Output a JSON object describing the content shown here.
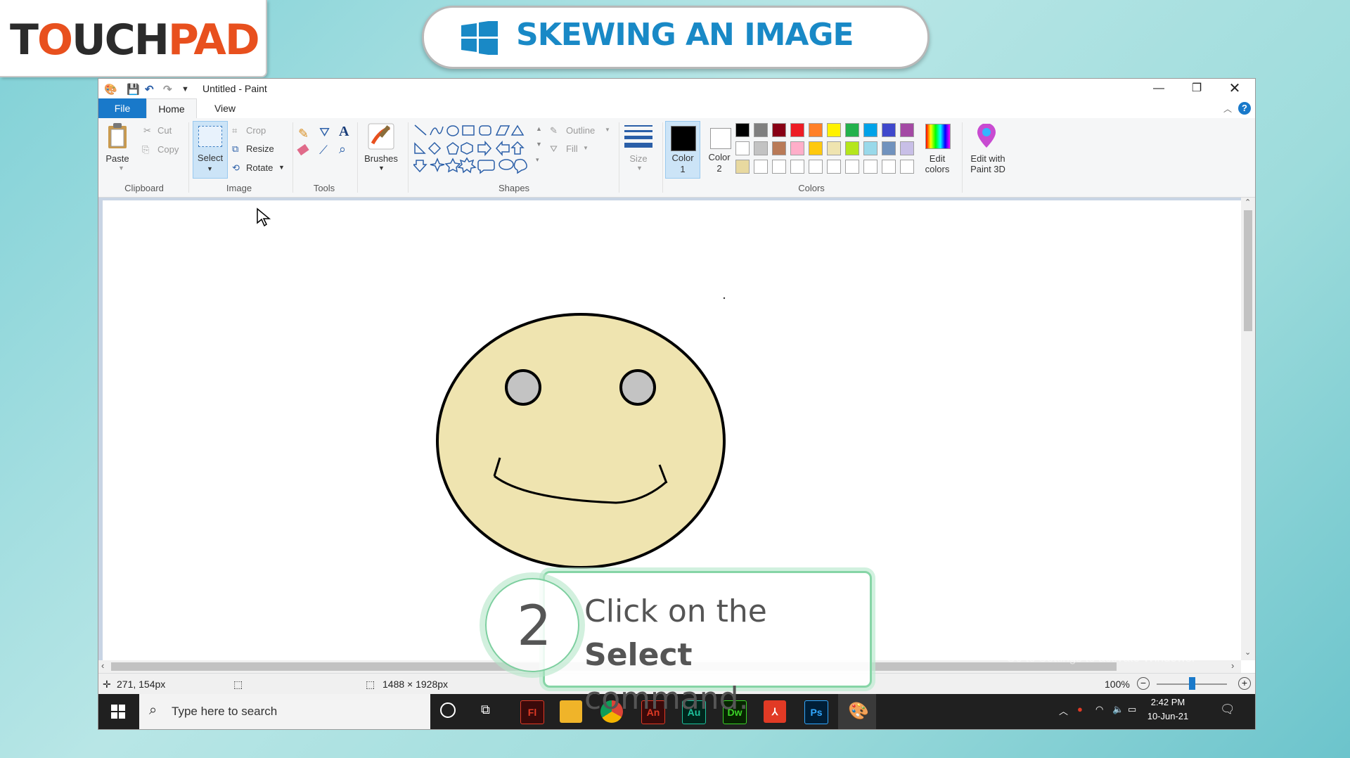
{
  "brand": {
    "logo_part1": "T",
    "logo_part2": "O",
    "logo_part3": "UCH",
    "logo_part4": "PAD"
  },
  "banner": {
    "title": "SKEWING AN IMAGE"
  },
  "window": {
    "title": "Untitled - Paint"
  },
  "tabs": [
    {
      "label": "File"
    },
    {
      "label": "Home"
    },
    {
      "label": "View"
    }
  ],
  "ribbon": {
    "clipboard": {
      "paste": "Paste",
      "cut": "Cut",
      "copy": "Copy",
      "group": "Clipboard"
    },
    "image": {
      "select": "Select",
      "crop": "Crop",
      "resize": "Resize",
      "rotate": "Rotate",
      "group": "Image"
    },
    "tools": {
      "group": "Tools"
    },
    "brushes": {
      "label": "Brushes"
    },
    "shapes": {
      "outline": "Outline",
      "fill": "Fill",
      "group": "Shapes"
    },
    "size": {
      "label": "Size"
    },
    "colors": {
      "color1": "Color",
      "color1_num": "1",
      "color2": "Color",
      "color2_num": "2",
      "edit_colors_1": "Edit",
      "edit_colors_2": "colors",
      "group": "Colors"
    },
    "paint3d": {
      "line1": "Edit with",
      "line2": "Paint 3D"
    },
    "palette_row1": [
      "#000000",
      "#7f7f7f",
      "#880015",
      "#ed1c24",
      "#ff7f27",
      "#fff200",
      "#22b14c",
      "#00a2e8",
      "#3f48cc",
      "#a349a4"
    ],
    "palette_row2": [
      "#ffffff",
      "#c3c3c3",
      "#b97a57",
      "#ffaec9",
      "#ffc90e",
      "#efe4b0",
      "#b5e61d",
      "#99d9ea",
      "#7092be",
      "#c8bfe7"
    ],
    "palette_row3": [
      "#e8d9a0",
      "#ffffff",
      "#ffffff",
      "#ffffff",
      "#ffffff",
      "#ffffff",
      "#ffffff",
      "#ffffff",
      "#ffffff",
      "#ffffff"
    ]
  },
  "status": {
    "cursor_pos": "271, 154px",
    "image_size": "1488 × 1928px",
    "zoom": "100%"
  },
  "taskbar": {
    "search_placeholder": "Type here to search",
    "time": "2:42 PM",
    "date": "10-Jun-21",
    "apps": [
      {
        "label": "Fl",
        "color": "#e13a25"
      },
      {
        "label": "An",
        "color": "#e13a25"
      },
      {
        "label": "Au",
        "color": "#1fc39e"
      },
      {
        "label": "Dw",
        "color": "#3bd427"
      },
      {
        "label": "Ps",
        "color": "#31a8ff"
      }
    ]
  },
  "callout": {
    "step": "2",
    "text_before": "Click on the ",
    "text_bold": "Select",
    "text_after": "command."
  },
  "watermark": "Go to Settings to activate Windows."
}
